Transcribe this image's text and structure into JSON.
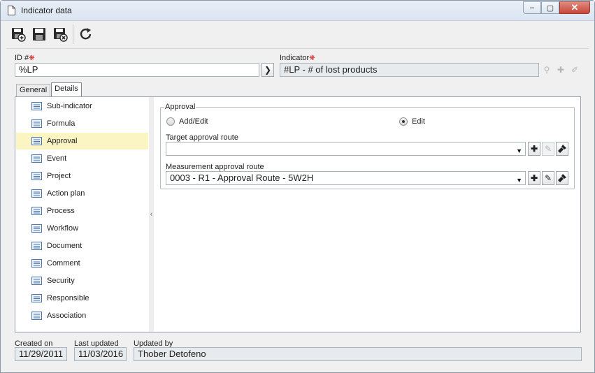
{
  "window": {
    "title": "Indicator data",
    "min_glyph": "▭",
    "max_glyph": "□",
    "close_glyph": "✕"
  },
  "toolbar": {
    "buttons": [
      "save-new-icon",
      "save-icon",
      "save-close-icon",
      "refresh-icon"
    ]
  },
  "header": {
    "id_label": "ID #",
    "id_value": "%LP",
    "indicator_label": "Indicator",
    "indicator_value": "#LP - # of lost products"
  },
  "tabs": [
    {
      "label": "General",
      "active": false
    },
    {
      "label": "Details",
      "active": true
    }
  ],
  "sidebar": {
    "items": [
      {
        "label": "Sub-indicator"
      },
      {
        "label": "Formula"
      },
      {
        "label": "Approval",
        "selected": true
      },
      {
        "label": "Event"
      },
      {
        "label": "Project"
      },
      {
        "label": "Action plan"
      },
      {
        "label": "Process"
      },
      {
        "label": "Workflow"
      },
      {
        "label": "Document"
      },
      {
        "label": "Comment"
      },
      {
        "label": "Security"
      },
      {
        "label": "Responsible"
      },
      {
        "label": "Association"
      }
    ]
  },
  "approval": {
    "group_label": "Approval",
    "radio_add_edit": "Add/Edit",
    "radio_edit": "Edit",
    "selected_option": "Edit",
    "target_route_label": "Target approval route",
    "target_route_value": "",
    "measurement_route_label": "Measurement approval route",
    "measurement_route_value": "0003 - R1 - Approval Route - 5W2H"
  },
  "footer": {
    "created_on_label": "Created on",
    "created_on_value": "11/29/2011",
    "last_updated_label": "Last updated",
    "last_updated_value": "11/03/2016",
    "updated_by_label": "Updated by",
    "updated_by_value": "Thober Detofeno"
  },
  "colors": {
    "selected_item_bg": "#fbf5c4",
    "required_marker": "#d42020",
    "close_button": "#c8473a"
  }
}
